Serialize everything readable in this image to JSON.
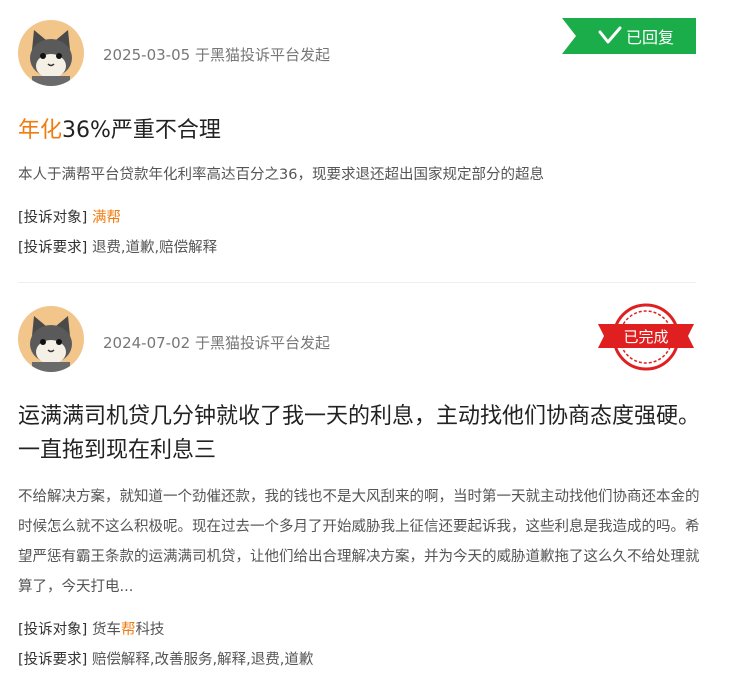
{
  "complaints": [
    {
      "date": "2025-03-05",
      "source": "于黑猫投诉平台发起",
      "status": "已回复",
      "status_color": "#1aad4a",
      "title_highlight": "年化",
      "title_rest": "36%严重不合理",
      "description": "本人于满帮平台贷款年化利率高达百分之36，现要求退还超出国家规定部分的超息",
      "target_label": "[投诉对象]",
      "target_value": "满帮",
      "demand_label": "[投诉要求]",
      "demand_value": "退费,道歉,赔偿解释"
    },
    {
      "date": "2024-07-02",
      "source": "于黑猫投诉平台发起",
      "status": "已完成",
      "status_color": "#e02020",
      "title": "运满满司机贷几分钟就收了我一天的利息，主动找他们协商态度强硬。一直拖到现在利息三",
      "description": "不给解决方案，就知道一个劲催还款，我的钱也不是大风刮来的啊，当时第一天就主动找他们协商还本金的时候怎么就不这么积极呢。现在过去一个多月了开始威胁我上征信还要起诉我，这些利息是我造成的吗。希望严惩有霸王条款的运满满司机贷，让他们给出合理解决方案，并为今天的威胁道歉拖了这么久不给处理就算了，今天打电...",
      "target_label": "[投诉对象]",
      "target_pre": "货车",
      "target_highlight": "帮",
      "target_post": "科技",
      "demand_label": "[投诉要求]",
      "demand_value": "赔偿解释,改善服务,解释,退费,道歉"
    }
  ]
}
